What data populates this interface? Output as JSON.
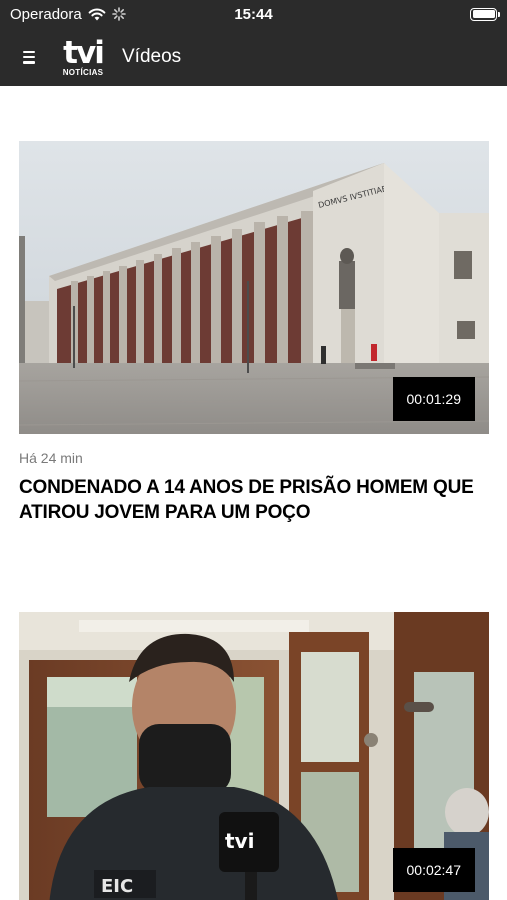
{
  "status_bar": {
    "carrier": "Operadora",
    "time": "15:44",
    "icons": [
      "wifi-icon",
      "activity-spinner-icon",
      "battery-icon"
    ]
  },
  "app_bar": {
    "logo_mark": "tvi",
    "logo_sub": "NOTÍCIAS",
    "title": "Vídeos",
    "icons": [
      "menu-icon"
    ]
  },
  "videos": [
    {
      "time_ago": "Há 24 min",
      "headline": "CONDENADO A 14 ANOS DE PRISÃO HOMEM QUE ATIROU JOVEM PARA UM POÇO",
      "duration": "00:01:29",
      "building_inscription": "DOMVS IVSTITIAE"
    },
    {
      "duration": "00:02:47",
      "badge_text": "EIC",
      "mic_logo": "tvi"
    }
  ]
}
